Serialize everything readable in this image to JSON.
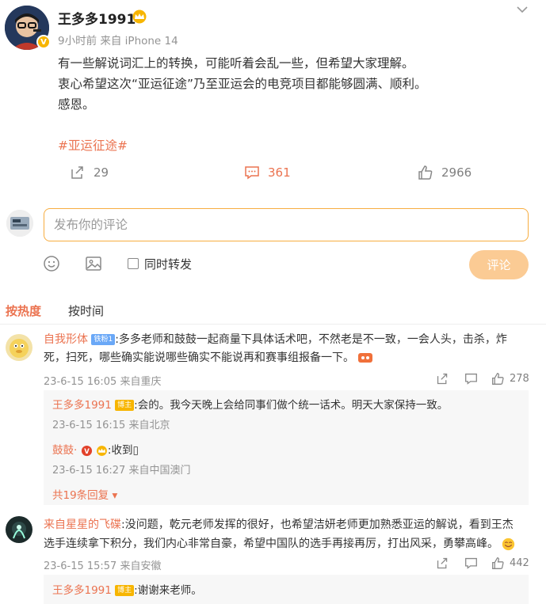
{
  "post": {
    "username": "王多多1991",
    "meta": "9小时前  来自 iPhone 14",
    "lines": [
      "有一些解说词汇上的转换，可能听着会乱一些，但希望大家理解。",
      "衷心希望这次“亚运征途”乃至亚运会的电竞项目都能够圆满、顺利。",
      "感恩。"
    ],
    "hashtag": "#亚运征途#",
    "repost_count": "29",
    "comment_count": "361",
    "like_count": "2966"
  },
  "composer": {
    "placeholder": "发布你的评论",
    "repost_label": "同时转发",
    "submit_label": "评论"
  },
  "tabs": {
    "hot": "按热度",
    "time": "按时间"
  },
  "comments": [
    {
      "user": "自我形体",
      "badge": "铁粉1",
      "text1": ":多多老师和鼓鼓一起商量下具体话术吧，不然老是不一致，一会人头，击杀，炸",
      "text2": "死，扫死，哪些确实能说哪些确实不能说再和赛事组报备一下。",
      "meta": "23-6-15 16:05 来自重庆",
      "likes": "278",
      "replies": [
        {
          "user": "王多多1991",
          "tag": "博主",
          "text": ":会的。我今天晚上会给同事们做个统一话术。明天大家保持一致。",
          "meta": "23-6-15 16:15 来自北京"
        },
        {
          "user": "鼓鼓·",
          "text": ":收到▯",
          "meta": "23-6-15 16:27 来自中国澳门"
        }
      ],
      "more": "共19条回复"
    },
    {
      "user": "来自星星的飞碟",
      "text1": ":没问题，乾元老师发挥的很好，也希望洁妍老师更加熟悉亚运的解说，看到王杰",
      "text2": "选手连续拿下积分，我们内心非常自豪，希望中国队的选手再接再厉，打出风采，勇攀高峰。",
      "meta": "23-6-15 15:57 来自安徽",
      "likes": "442",
      "replies": [
        {
          "user": "王多多1991",
          "tag": "博主",
          "text": ":谢谢来老师。"
        }
      ]
    }
  ],
  "colors": {
    "accent": "#eb7350",
    "input_border": "#f7ad40",
    "submit_bg": "#fbcb94"
  }
}
